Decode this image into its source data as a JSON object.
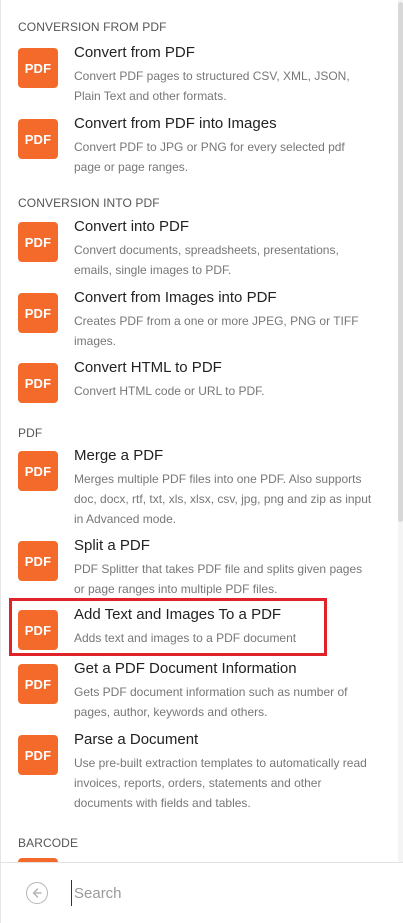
{
  "sections": [
    {
      "header": "CONVERSION FROM PDF",
      "items": [
        {
          "icon": "PDF",
          "title": "Convert from PDF",
          "desc": "Convert PDF pages to structured CSV, XML, JSON, Plain Text and other formats."
        },
        {
          "icon": "PDF",
          "title": "Convert from PDF into Images",
          "desc": "Convert PDF to JPG or PNG for every selected pdf page or page ranges."
        }
      ]
    },
    {
      "header": "CONVERSION INTO PDF",
      "items": [
        {
          "icon": "PDF",
          "title": "Convert into PDF",
          "desc": "Convert documents, spreadsheets, presentations, emails, single images to PDF."
        },
        {
          "icon": "PDF",
          "title": "Convert from Images into PDF",
          "desc": "Creates PDF from a one or more JPEG, PNG or TIFF images."
        },
        {
          "icon": "PDF",
          "title": "Convert HTML to PDF",
          "desc": "Convert HTML code or URL to PDF."
        }
      ]
    },
    {
      "header": "PDF",
      "items": [
        {
          "icon": "PDF",
          "title": "Merge a PDF",
          "desc": "Merges multiple PDF files into one PDF. Also supports doc, docx, rtf, txt, xls, xlsx, csv, jpg, png and zip as input in Advanced mode."
        },
        {
          "icon": "PDF",
          "title": "Split a PDF",
          "desc": "PDF Splitter that takes PDF file and splits given pages or page ranges into multiple PDF files."
        },
        {
          "icon": "PDF",
          "title": "Add Text and Images To a PDF",
          "desc": "Adds text and images to a PDF document"
        },
        {
          "icon": "PDF",
          "title": "Get a PDF Document Information",
          "desc": "Gets PDF document information such as number of pages, author, keywords and others."
        },
        {
          "icon": "PDF",
          "title": "Parse a Document",
          "desc": "Use pre-built extraction templates to automatically read invoices, reports, orders, statements and other documents with fields and tables."
        }
      ]
    },
    {
      "header": "BARCODE",
      "items": []
    }
  ],
  "highlighted_item": "Add Text and Images To a PDF",
  "colors": {
    "badge": "#f36a2a",
    "highlight": "#e0232a"
  },
  "search": {
    "placeholder": "Search",
    "value": ""
  },
  "back_icon": "arrow-left-circle-icon"
}
